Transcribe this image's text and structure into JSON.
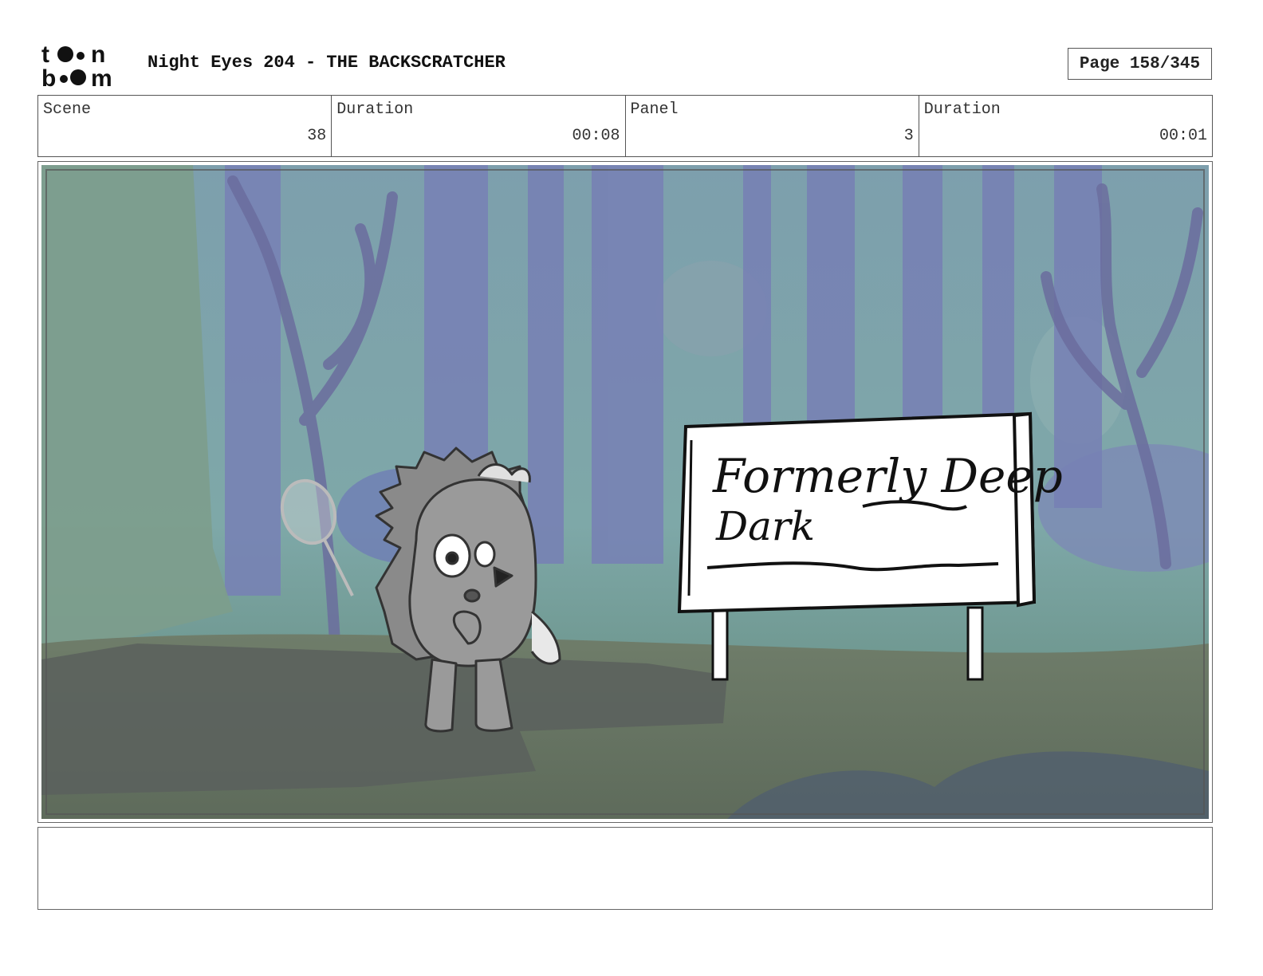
{
  "header": {
    "logo_alt": "toon boom",
    "title": "Night Eyes 204 - THE BACKSCRATCHER",
    "page": "Page 158/345"
  },
  "info": [
    {
      "label": "Scene",
      "value": "38"
    },
    {
      "label": "Duration",
      "value": "00:08"
    },
    {
      "label": "Panel",
      "value": "3"
    },
    {
      "label": "Duration",
      "value": "00:01"
    }
  ],
  "panel": {
    "sign_line1": "Formerly Deep",
    "sign_line2": "Dark"
  },
  "notes": ""
}
